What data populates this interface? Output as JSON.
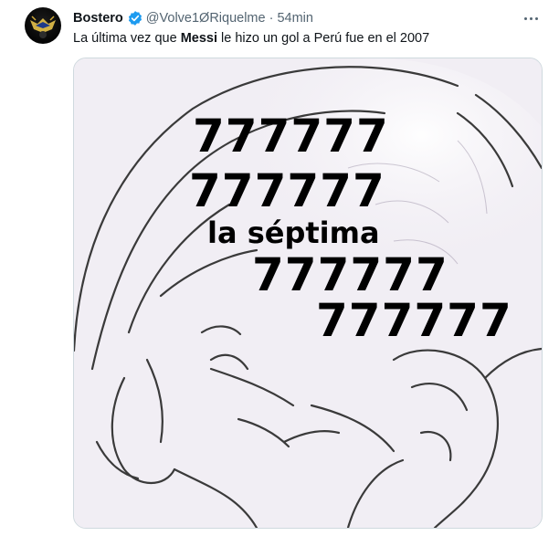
{
  "tweet": {
    "display_name": "Bostero",
    "handle": "@Volve1ØRiquelme",
    "separator": "·",
    "time": "54min",
    "text_before": "La última vez que ",
    "text_bold": "Messi",
    "text_after": " le hizo un gol a Perú fue en el 2007"
  },
  "meme": {
    "line1": "777777",
    "line2": "777777",
    "line3": "la séptima",
    "line4": "777777",
    "line5": "777777"
  },
  "icons": {
    "verified": "verified-badge-icon",
    "more": "more-options-icon"
  },
  "colors": {
    "verified_blue": "#1d9bf0",
    "secondary_text": "#536471",
    "media_background": "#f1eef4"
  }
}
